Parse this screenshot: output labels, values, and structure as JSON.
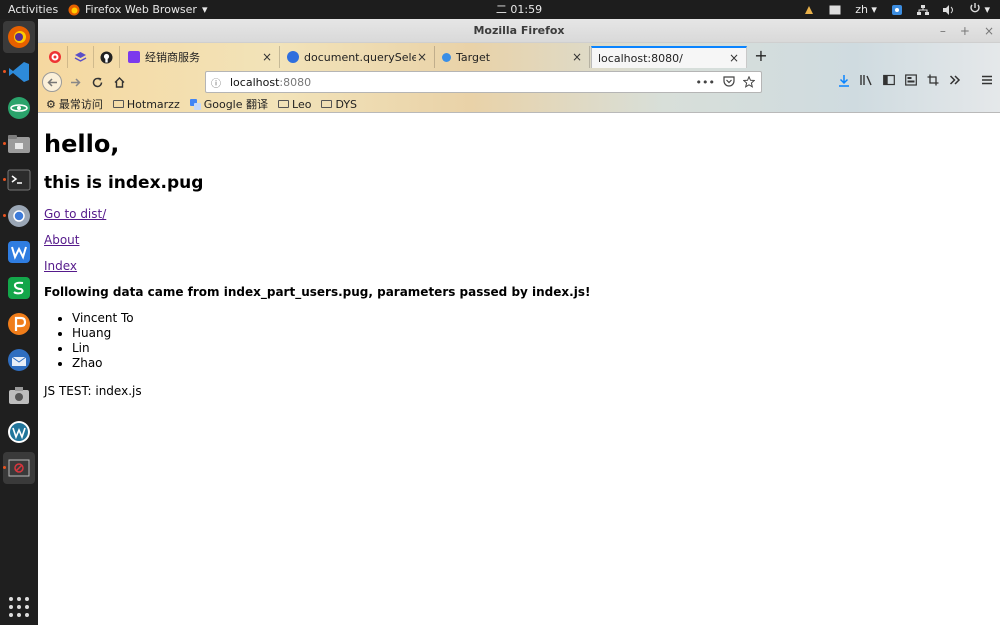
{
  "topbar": {
    "activities": "Activities",
    "app_menu": "Firefox Web Browser",
    "clock": "二 01:59",
    "lang": "zh"
  },
  "window": {
    "title": "Mozilla Firefox",
    "minimize": "–",
    "maximize": "+",
    "close": "×"
  },
  "tabs": [
    {
      "label": "经销商服务",
      "color": "#7c3aed"
    },
    {
      "label": "document.querySelec",
      "color": "#2f6fde"
    },
    {
      "label": "Target",
      "color": "#3a8ee6"
    },
    {
      "label": "localhost:8080/",
      "color": ""
    }
  ],
  "tab_close": "×",
  "new_tab": "+",
  "url": {
    "host": "localhost",
    "port": ":8080"
  },
  "bookmarks": [
    {
      "label": "最常访问",
      "icon": "gear-icon"
    },
    {
      "label": "Hotmarzz",
      "icon": "folder-icon"
    },
    {
      "label": "Google 翻译",
      "icon": "translate-icon"
    },
    {
      "label": "Leo",
      "icon": "folder-icon"
    },
    {
      "label": "DYS",
      "icon": "folder-icon"
    }
  ],
  "page": {
    "h1": "hello,",
    "h2": "this is index.pug",
    "links": [
      "Go to dist/",
      "About",
      "Index"
    ],
    "users_heading": "Following data came from index_part_users.pug, parameters passed by index.js!",
    "users": [
      "Vincent To",
      "Huang",
      "Lin",
      "Zhao"
    ],
    "js_test": "JS TEST: index.js"
  },
  "colors": {
    "link": "#551a8b",
    "accent": "#0a84ff",
    "ubuntu_orange": "#e95420"
  }
}
